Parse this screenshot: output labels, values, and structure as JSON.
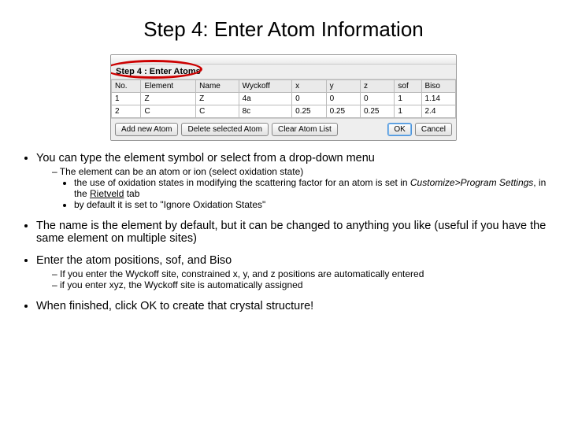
{
  "title": "Step 4: Enter Atom Information",
  "screenshot": {
    "step_label": "Step 4 : Enter Atoms",
    "headers": [
      "No.",
      "Element",
      "Name",
      "Wyckoff",
      "x",
      "y",
      "z",
      "sof",
      "Biso"
    ],
    "rows": [
      [
        "1",
        "Z",
        "Z",
        "4a",
        "0",
        "0",
        "0",
        "1",
        "1.14"
      ],
      [
        "2",
        "C",
        "C",
        "8c",
        "0.25",
        "0.25",
        "0.25",
        "1",
        "2.4"
      ]
    ],
    "buttons": {
      "add": "Add new Atom",
      "del": "Delete selected Atom",
      "clear": "Clear Atom List",
      "ok": "OK",
      "cancel": "Cancel"
    }
  },
  "b1": {
    "lead": "You can type the element symbol or select from a drop-down menu",
    "d1": "The element can be an atom or ion (select oxidation state)",
    "s1a": "the use of oxidation states in modifying the scattering factor for an atom is set in ",
    "s1b": "Customize>Program Settings",
    "s1c": ", in the ",
    "s1d": "Rietveld",
    "s1e": " tab",
    "s2": "by default it is set to \"Ignore Oxidation States\""
  },
  "b2": "The name is the element by default, but it can be changed to anything you like (useful if you have the same element on multiple sites)",
  "b3": {
    "lead": "Enter the atom positions, sof, and Biso",
    "d1": "If you enter the Wyckoff site, constrained x, y, and z positions are automatically entered",
    "d2": "if you enter xyz, the Wyckoff site is automatically assigned"
  },
  "b4": "When finished, click OK to create that crystal structure!"
}
